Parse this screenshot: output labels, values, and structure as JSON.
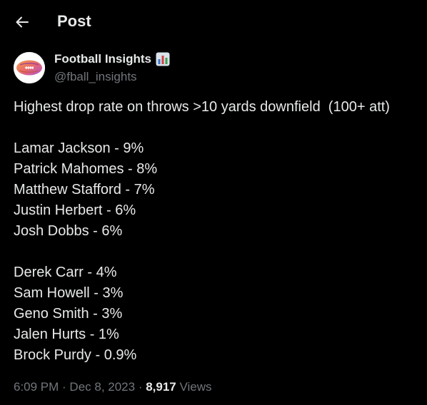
{
  "header": {
    "title": "Post",
    "back_icon": "arrow-left-icon"
  },
  "author": {
    "name": "Football Insights",
    "name_emoji": "bar-chart-icon",
    "handle": "@fball_insights",
    "avatar_icon": "football-avatar"
  },
  "post": {
    "intro": "Highest drop rate on throws >10 yards downfield  (100+ att)",
    "group1": [
      "Lamar Jackson - 9%",
      "Patrick Mahomes - 8%",
      "Matthew Stafford - 7%",
      "Justin Herbert - 6%",
      "Josh Dobbs - 6%"
    ],
    "group2": [
      "Derek Carr - 4%",
      "Sam Howell - 3%",
      "Geno Smith - 3%",
      "Jalen Hurts - 1%",
      "Brock Purdy - 0.9%"
    ]
  },
  "meta": {
    "time": "6:09 PM",
    "separator": " · ",
    "date": "Dec 8, 2023",
    "views_count": "8,917",
    "views_label": "Views"
  },
  "colors": {
    "background": "#000000",
    "text": "#e7e9ea",
    "secondary": "#71767b"
  }
}
